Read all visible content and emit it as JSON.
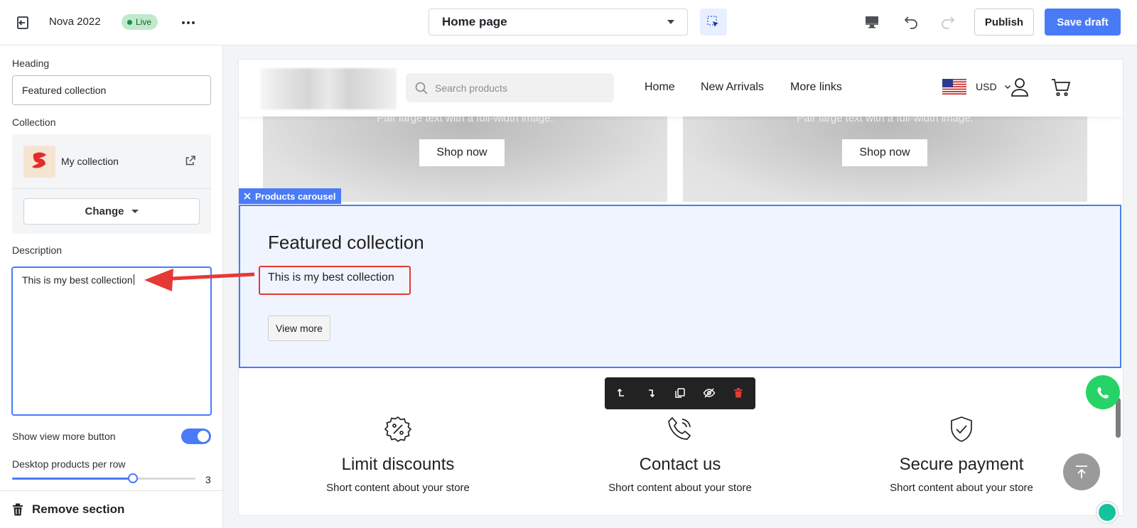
{
  "topbar": {
    "store_name": "Nova 2022",
    "status_badge": "Live",
    "page_selector": "Home page",
    "publish_label": "Publish",
    "save_label": "Save draft"
  },
  "sidebar": {
    "heading_label": "Heading",
    "heading_value": "Featured collection",
    "collection_label": "Collection",
    "collection_name": "My collection",
    "change_label": "Change",
    "description_label": "Description",
    "description_value": "This is my best collection",
    "show_view_more_label": "Show view more button",
    "show_view_more_enabled": true,
    "products_per_row_label": "Desktop products per row",
    "products_per_row_value": "3",
    "products_per_row_fraction": 0.66,
    "remove_label": "Remove section"
  },
  "preview": {
    "search_placeholder": "Search products",
    "nav": [
      "Home",
      "New Arrivals",
      "More links"
    ],
    "currency": "USD",
    "banner_text": "Pair large text with a full-width image.",
    "shop_now": "Shop now",
    "section_tag": "Products carousel",
    "section_title": "Featured collection",
    "section_desc": "This is my best collection",
    "view_more": "View more",
    "features": [
      {
        "icon": "discount-badge-icon",
        "title": "Limit discounts",
        "text": "Short content about your store"
      },
      {
        "icon": "phone-call-icon",
        "title": "Contact us",
        "text": "Short content about your store"
      },
      {
        "icon": "shield-check-icon",
        "title": "Secure payment",
        "text": "Short content about your store"
      }
    ]
  },
  "colors": {
    "accent": "#4a7bf7",
    "live_badge_bg": "#bfeacb",
    "annotation_red": "#e53935",
    "whatsapp": "#25d366"
  }
}
